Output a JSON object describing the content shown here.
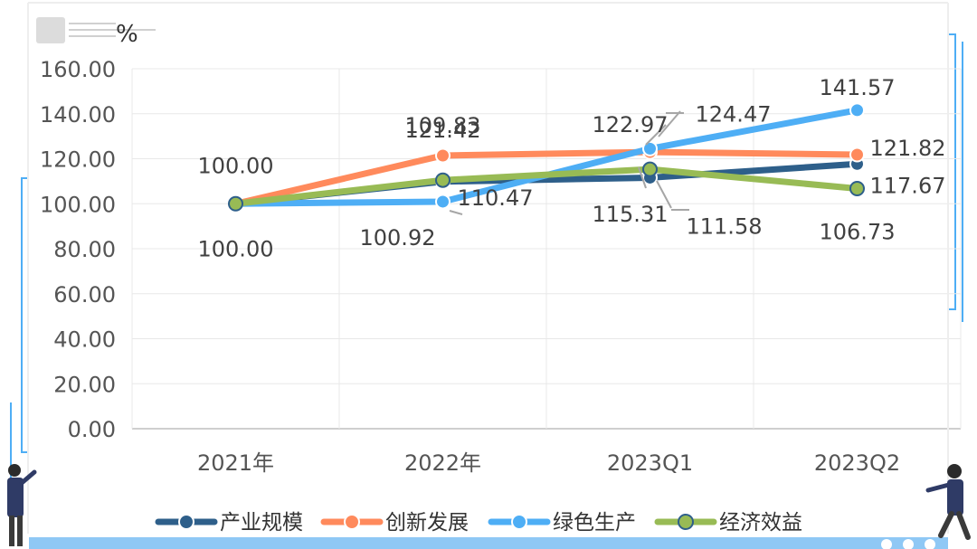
{
  "chart_data": {
    "type": "line",
    "unit": "%",
    "categories": [
      "2021年",
      "2022年",
      "2023Q1",
      "2023Q2"
    ],
    "ylim": [
      0,
      160
    ],
    "yticks": [
      "0.00",
      "20.00",
      "40.00",
      "60.00",
      "80.00",
      "100.00",
      "120.00",
      "140.00",
      "160.00"
    ],
    "grid": true,
    "legend_position": "bottom",
    "series": [
      {
        "name": "产业规模",
        "color": "#2e5f8a",
        "values": [
          100.0,
          109.83,
          111.58,
          117.67
        ]
      },
      {
        "name": "创新发展",
        "color": "#ff8a5c",
        "values": [
          100.0,
          121.42,
          122.97,
          121.82
        ]
      },
      {
        "name": "绿色生产",
        "color": "#4eaef5",
        "values": [
          100.0,
          100.92,
          124.47,
          141.57
        ]
      },
      {
        "name": "经济效益",
        "color": "#98bb55",
        "values": [
          100.0,
          110.47,
          115.31,
          106.73
        ]
      }
    ],
    "data_labels": [
      {
        "text": "100.00",
        "series": "创新发展",
        "index": 0
      },
      {
        "text": "100.00",
        "series": "产业规模",
        "index": 0
      },
      {
        "text": "121.42",
        "series": "创新发展",
        "index": 1
      },
      {
        "text": "109.83",
        "series": "产业规模",
        "index": 1
      },
      {
        "text": "100.92",
        "series": "绿色生产",
        "index": 1
      },
      {
        "text": "110.47",
        "series": "经济效益",
        "index": 1
      },
      {
        "text": "122.97",
        "series": "创新发展",
        "index": 2
      },
      {
        "text": "124.47",
        "series": "绿色生产",
        "index": 2
      },
      {
        "text": "115.31",
        "series": "经济效益",
        "index": 2
      },
      {
        "text": "111.58",
        "series": "产业规模",
        "index": 2
      },
      {
        "text": "141.57",
        "series": "绿色生产",
        "index": 3
      },
      {
        "text": "121.82",
        "series": "创新发展",
        "index": 3
      },
      {
        "text": "117.67",
        "series": "产业规模",
        "index": 3
      },
      {
        "text": "106.73",
        "series": "经济效益",
        "index": 3
      }
    ]
  },
  "decor": {
    "accent_color": "#4eaef5",
    "bottom_bar_color": "#8fc8f5"
  }
}
